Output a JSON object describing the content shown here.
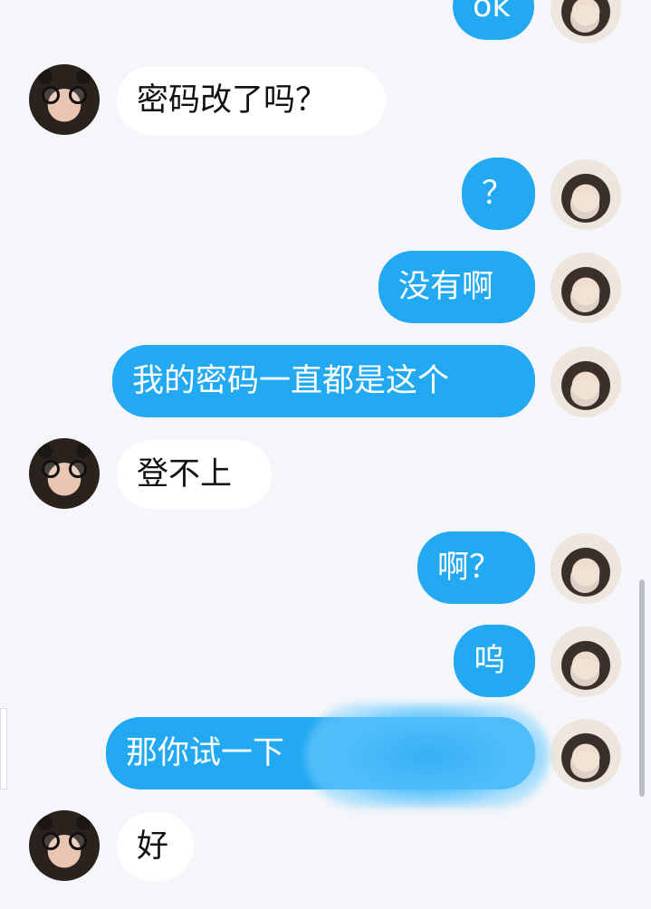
{
  "messages": [
    {
      "sender": "me",
      "text": "ok"
    },
    {
      "sender": "other",
      "text": "密码改了吗？"
    },
    {
      "sender": "me",
      "text": "？"
    },
    {
      "sender": "me",
      "text": "没有啊"
    },
    {
      "sender": "me",
      "text": "我的密码一直都是这个"
    },
    {
      "sender": "other",
      "text": "登不上"
    },
    {
      "sender": "me",
      "text": "啊？"
    },
    {
      "sender": "me",
      "text": "呜"
    },
    {
      "sender": "me",
      "text": "那你试一下"
    },
    {
      "sender": "other",
      "text": "好"
    }
  ],
  "colors": {
    "background": "#f4f6f9",
    "incoming_bubble": "#ffffff",
    "outgoing_bubble": "#23a9f2"
  }
}
